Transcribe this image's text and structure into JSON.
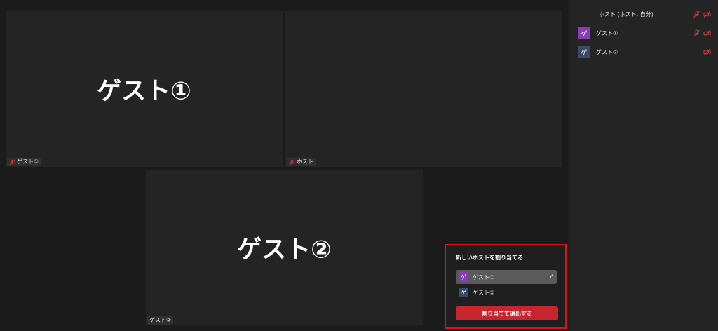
{
  "tiles": [
    {
      "name": "ゲスト①",
      "label": "ゲスト①"
    },
    {
      "name": "",
      "label": "ホスト"
    },
    {
      "name": "ゲスト②",
      "label": "ゲスト②"
    }
  ],
  "participants": [
    {
      "name": "ホスト (ホスト, 自分)",
      "avatar": ""
    },
    {
      "name": "ゲスト①",
      "avatar": "ゲ",
      "avatar_color": "#8c3bb8"
    },
    {
      "name": "ゲスト②",
      "avatar": "ゲ",
      "avatar_color": "#3a4a66"
    }
  ],
  "dialog": {
    "title": "新しいホストを割り当てる",
    "options": [
      {
        "avatar": "ゲ",
        "label": "ゲスト①",
        "selected": true,
        "avatar_color": "#8c3bb8"
      },
      {
        "avatar": "ゲ",
        "label": "ゲスト②",
        "selected": false,
        "avatar_color": "#3a4a66"
      }
    ],
    "check_mark": "✓",
    "button_label": "割り当てて退出する"
  },
  "icons": {
    "mic_off": "microphone-off-icon",
    "camera_off": "camera-off-icon",
    "status_color": "#d23a3a"
  },
  "colors": {
    "highlight_border": "#e00f1e",
    "button": "#c7262e"
  }
}
